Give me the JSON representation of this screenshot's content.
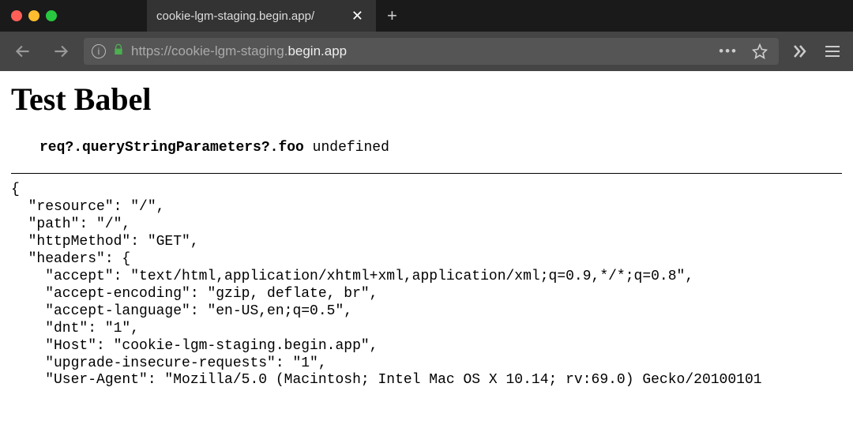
{
  "window": {
    "tab_title": "cookie-lgm-staging.begin.app/",
    "url_scheme": "https://",
    "url_host_muted": "cookie-lgm-staging.",
    "url_host_strong": "begin.app"
  },
  "page": {
    "heading": "Test Babel",
    "query_label": "req?.queryStringParameters?.foo",
    "query_value": "undefined",
    "json_text": "{\n  \"resource\": \"/\",\n  \"path\": \"/\",\n  \"httpMethod\": \"GET\",\n  \"headers\": {\n    \"accept\": \"text/html,application/xhtml+xml,application/xml;q=0.9,*/*;q=0.8\",\n    \"accept-encoding\": \"gzip, deflate, br\",\n    \"accept-language\": \"en-US,en;q=0.5\",\n    \"dnt\": \"1\",\n    \"Host\": \"cookie-lgm-staging.begin.app\",\n    \"upgrade-insecure-requests\": \"1\",\n    \"User-Agent\": \"Mozilla/5.0 (Macintosh; Intel Mac OS X 10.14; rv:69.0) Gecko/20100101"
  },
  "icons": {
    "close": "✕",
    "plus": "+",
    "info": "i",
    "more": "•••"
  }
}
